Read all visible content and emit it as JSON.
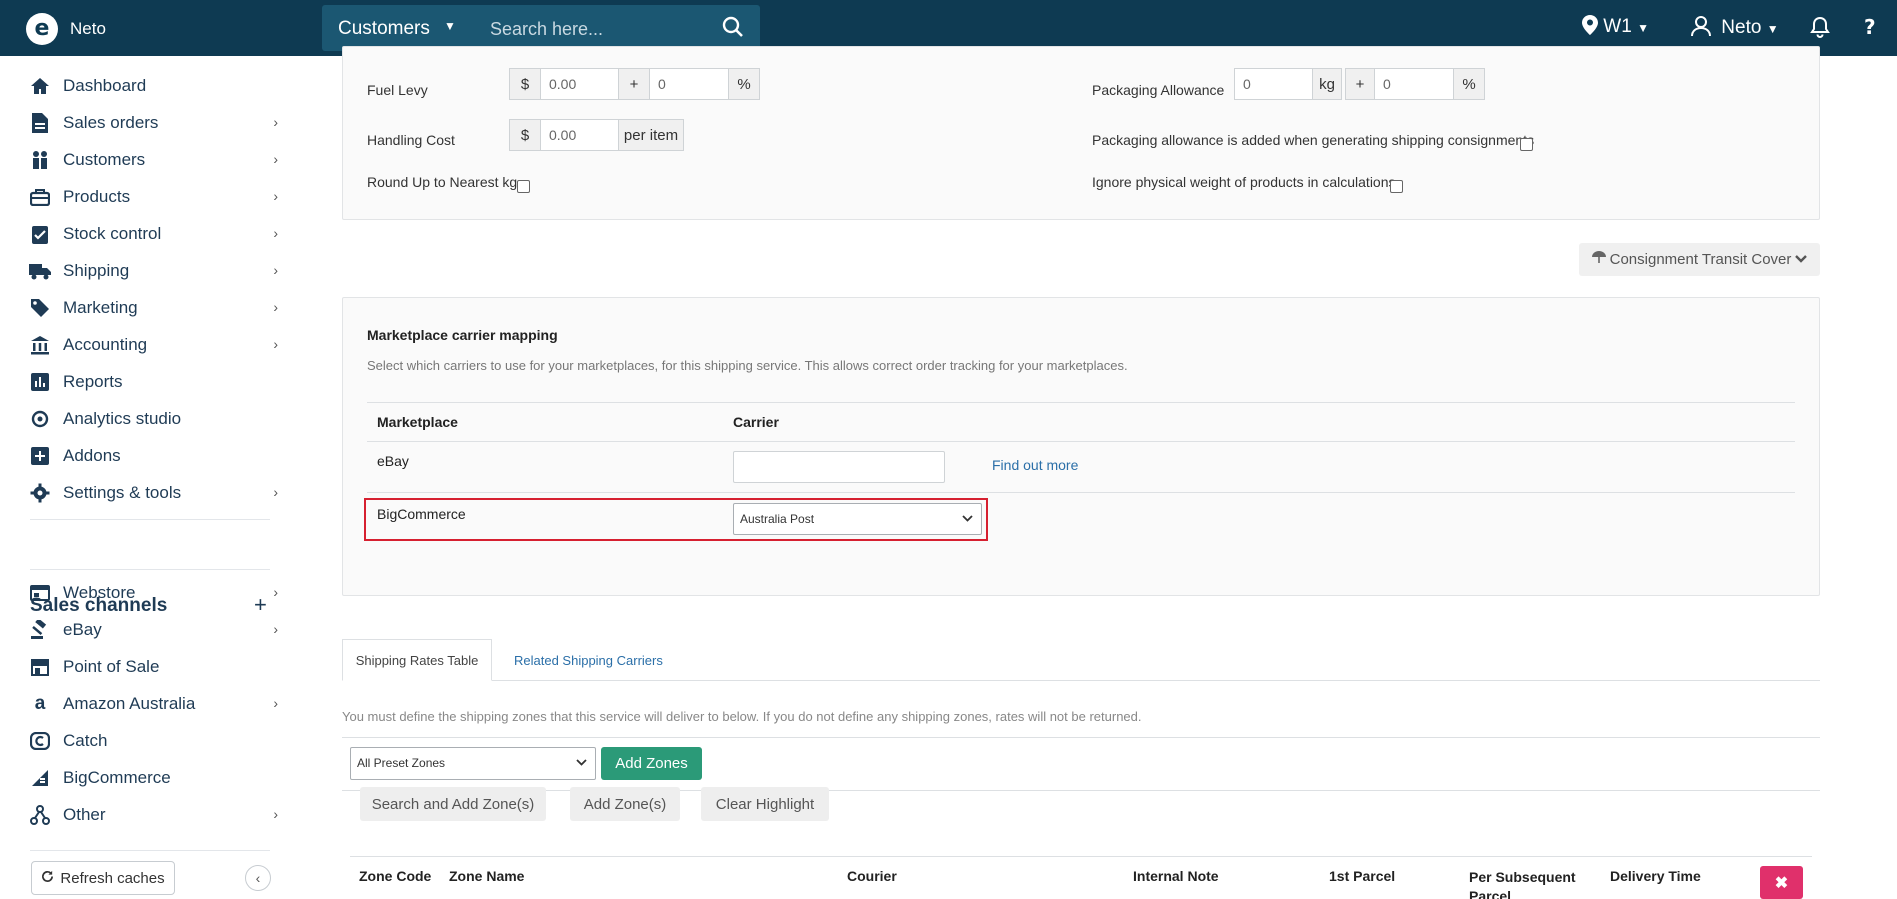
{
  "topbar": {
    "brand": "Neto",
    "search_scope": "Customers",
    "search_placeholder": "Search here...",
    "location": "W1",
    "user": "Neto"
  },
  "sidebar": {
    "items": [
      {
        "label": "Dashboard",
        "icon": "home-icon",
        "has_children": false
      },
      {
        "label": "Sales orders",
        "icon": "document-icon",
        "has_children": true
      },
      {
        "label": "Customers",
        "icon": "people-icon",
        "has_children": true
      },
      {
        "label": "Products",
        "icon": "box-icon",
        "has_children": true
      },
      {
        "label": "Stock control",
        "icon": "clipboard-check-icon",
        "has_children": true
      },
      {
        "label": "Shipping",
        "icon": "truck-icon",
        "has_children": true
      },
      {
        "label": "Marketing",
        "icon": "tag-icon",
        "has_children": true
      },
      {
        "label": "Accounting",
        "icon": "bank-icon",
        "has_children": true
      },
      {
        "label": "Reports",
        "icon": "bar-chart-icon",
        "has_children": false
      },
      {
        "label": "Analytics studio",
        "icon": "analytics-icon",
        "has_children": false
      },
      {
        "label": "Addons",
        "icon": "plus-square-icon",
        "has_children": false
      },
      {
        "label": "Settings & tools",
        "icon": "gear-icon",
        "has_children": true
      }
    ],
    "sales_channels_title": "Sales channels",
    "channels": [
      {
        "label": "Webstore",
        "icon": "browser-icon",
        "has_children": true
      },
      {
        "label": "eBay",
        "icon": "gavel-icon",
        "has_children": true
      },
      {
        "label": "Point of Sale",
        "icon": "store-icon",
        "has_children": false
      },
      {
        "label": "Amazon Australia",
        "icon": "amazon-icon",
        "has_children": true
      },
      {
        "label": "Catch",
        "icon": "catch-icon",
        "has_children": false
      },
      {
        "label": "BigCommerce",
        "icon": "bigcommerce-icon",
        "has_children": false
      },
      {
        "label": "Other",
        "icon": "network-icon",
        "has_children": true
      }
    ],
    "refresh_label": "Refresh caches"
  },
  "cost_panel": {
    "fuel_levy_label": "Fuel Levy",
    "fuel_levy_currency": "$",
    "fuel_levy_value": "0.00",
    "fuel_levy_plus": "+",
    "fuel_levy_percent_value": "0",
    "fuel_levy_percent": "%",
    "handling_cost_label": "Handling Cost",
    "handling_currency": "$",
    "handling_value": "0.00",
    "handling_unit": "per item",
    "round_up_label": "Round Up to Nearest kg",
    "packaging_allowance_label": "Packaging Allowance",
    "packaging_value": "0",
    "packaging_unit": "kg",
    "packaging_plus": "+",
    "packaging_percent_value": "0",
    "packaging_percent": "%",
    "packaging_consignment_label": "Packaging allowance is added when generating shipping consignments",
    "ignore_weight_label": "Ignore physical weight of products in calculations"
  },
  "transit_cover_label": "Consignment Transit Cover",
  "marketplace_mapping": {
    "title": "Marketplace carrier mapping",
    "description": "Select which carriers to use for your marketplaces, for this shipping service. This allows correct order tracking for your marketplaces.",
    "col_marketplace": "Marketplace",
    "col_carrier": "Carrier",
    "rows": [
      {
        "marketplace": "eBay",
        "carrier": "",
        "link": "Find out more"
      },
      {
        "marketplace": "BigCommerce",
        "carrier": "Australia Post"
      }
    ]
  },
  "tabs": {
    "active": "Shipping Rates Table",
    "other": "Related Shipping Carriers"
  },
  "zones": {
    "notice": "You must define the shipping zones that this service will deliver to below. If you do not define any shipping zones, rates will not be returned.",
    "preset_select": "All Preset Zones",
    "add_zones_label": "Add Zones",
    "search_add_label": "Search and Add Zone(s)",
    "add_zone_label": "Add Zone(s)",
    "clear_highlight_label": "Clear Highlight",
    "columns": [
      "Zone Code",
      "Zone Name",
      "Courier",
      "Internal Note",
      "1st Parcel",
      "Per Subsequent Parcel",
      "Delivery Time"
    ]
  }
}
